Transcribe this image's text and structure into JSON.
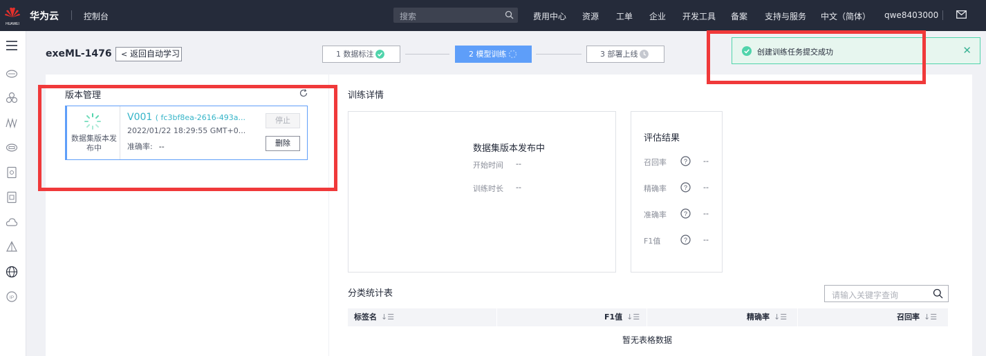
{
  "topbar": {
    "logo_text": "HUAWEI",
    "brand": "华为云",
    "console": "控制台",
    "search_placeholder": "搜索",
    "nav": [
      "费用中心",
      "资源",
      "工单",
      "企业",
      "开发工具",
      "备案",
      "支持与服务",
      "中文（简体）",
      "qwe8403000"
    ]
  },
  "page": {
    "title": "exeML-1476",
    "back_label": "返回自动学习",
    "steps": [
      "1 数据标注",
      "2 模型训练",
      "3 部署上线"
    ]
  },
  "toast": {
    "message": "创建训练任务提交成功",
    "close": "✕"
  },
  "version_panel": {
    "title": "版本管理",
    "card": {
      "status": "数据集版本发布中",
      "version": "V001",
      "id": "( fc3bf8ea-2616-493a...",
      "time": "2022/01/22 18:29:55 GMT+0...",
      "accuracy_label": "准确率:",
      "accuracy_value": "--",
      "stop_label": "停止",
      "delete_label": "删除"
    }
  },
  "training": {
    "title": "训练详情",
    "status_box": {
      "heading": "数据集版本发布中",
      "start_label": "开始时间",
      "start_value": "--",
      "duration_label": "训练时长",
      "duration_value": "--"
    },
    "eval": {
      "title": "评估结果",
      "metrics": [
        {
          "label": "召回率",
          "value": "--"
        },
        {
          "label": "精确率",
          "value": "--"
        },
        {
          "label": "准确率",
          "value": "--"
        },
        {
          "label": "F1值",
          "value": "--"
        }
      ]
    },
    "stats": {
      "title": "分类统计表",
      "filter_placeholder": "请输入关键字查询",
      "columns": [
        "标签名",
        "F1值",
        "精确率",
        "召回率"
      ],
      "empty": "暂无表格数据"
    }
  },
  "colors": {
    "topbar": "#252b3a",
    "accent": "#5e9ef9",
    "success": "#50d4ab",
    "highlight": "#f0393a"
  }
}
